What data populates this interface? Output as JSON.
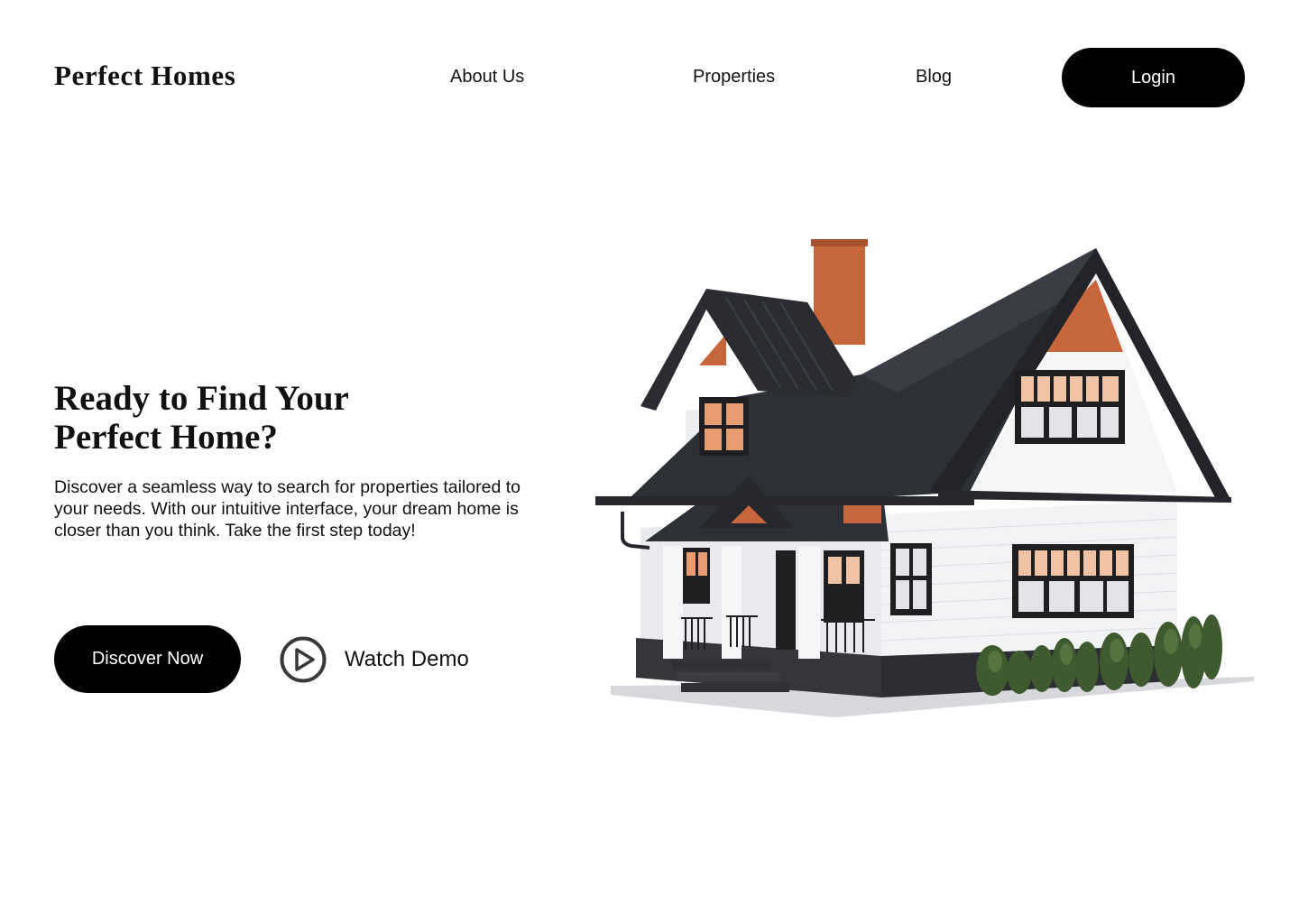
{
  "header": {
    "logo": "Perfect Homes",
    "nav": [
      {
        "label": "About Us"
      },
      {
        "label": "Properties"
      },
      {
        "label": "Blog"
      }
    ],
    "login_label": "Login"
  },
  "hero": {
    "title_line1": "Ready to Find Your",
    "title_line2": "Perfect Home?",
    "description": "Discover a seamless way to search for properties tailored to your needs. With our intuitive interface, your dream home is closer than you think. Take the first step today!",
    "primary_cta": "Discover Now",
    "secondary_cta": "Watch Demo",
    "secondary_icon": "play-circle-icon"
  },
  "colors": {
    "background": "#ffffff",
    "button": "#000000",
    "button_text": "#ffffff",
    "text": "#111111",
    "roof": "#2b2d33",
    "chimney": "#c8663b",
    "siding": "#f3f4f6",
    "window_frame": "#1f1f22"
  }
}
